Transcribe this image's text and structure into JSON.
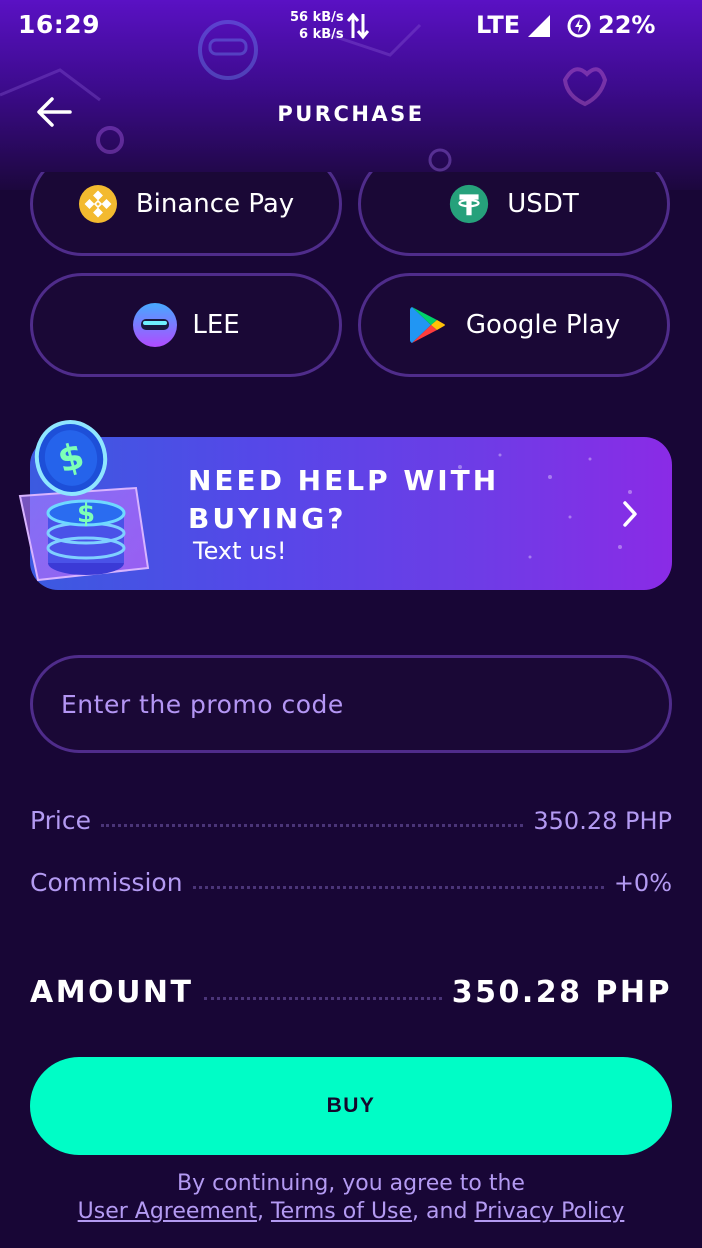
{
  "status_bar": {
    "time": "16:29",
    "net_down": "56 kB/s",
    "net_up": "6 kB/s",
    "network": "LTE",
    "battery": "22%"
  },
  "header": {
    "title": "PURCHASE",
    "back_icon": "arrow-left-icon"
  },
  "payment_methods": [
    {
      "label": "Binance Pay",
      "icon": "binance-icon"
    },
    {
      "label": "USDT",
      "icon": "tether-icon"
    },
    {
      "label": "LEE",
      "icon": "lee-token-icon"
    },
    {
      "label": "Google Play",
      "icon": "google-play-icon"
    }
  ],
  "help_banner": {
    "title": "NEED HELP WITH BUYING?",
    "subtitle": "Text us!",
    "icon": "chevron-right-icon"
  },
  "promo": {
    "placeholder": "Enter the promo code"
  },
  "summary": {
    "price_label": "Price",
    "price_value": "350.28 PHP",
    "commission_label": "Commission",
    "commission_value": "+0%",
    "amount_label": "AMOUNT",
    "amount_value": "350.28 PHP"
  },
  "buy_label": "BUY",
  "legal": {
    "prefix": "By continuing, you agree to the",
    "user_agreement": "User Agreement",
    "sep1": ", ",
    "terms": "Terms of Use",
    "sep2": ", and ",
    "privacy": "Privacy Policy"
  },
  "colors": {
    "background": "#180636",
    "accent": "#00fdc6",
    "muted_text": "#b39af2",
    "border": "#4f2c8b"
  }
}
